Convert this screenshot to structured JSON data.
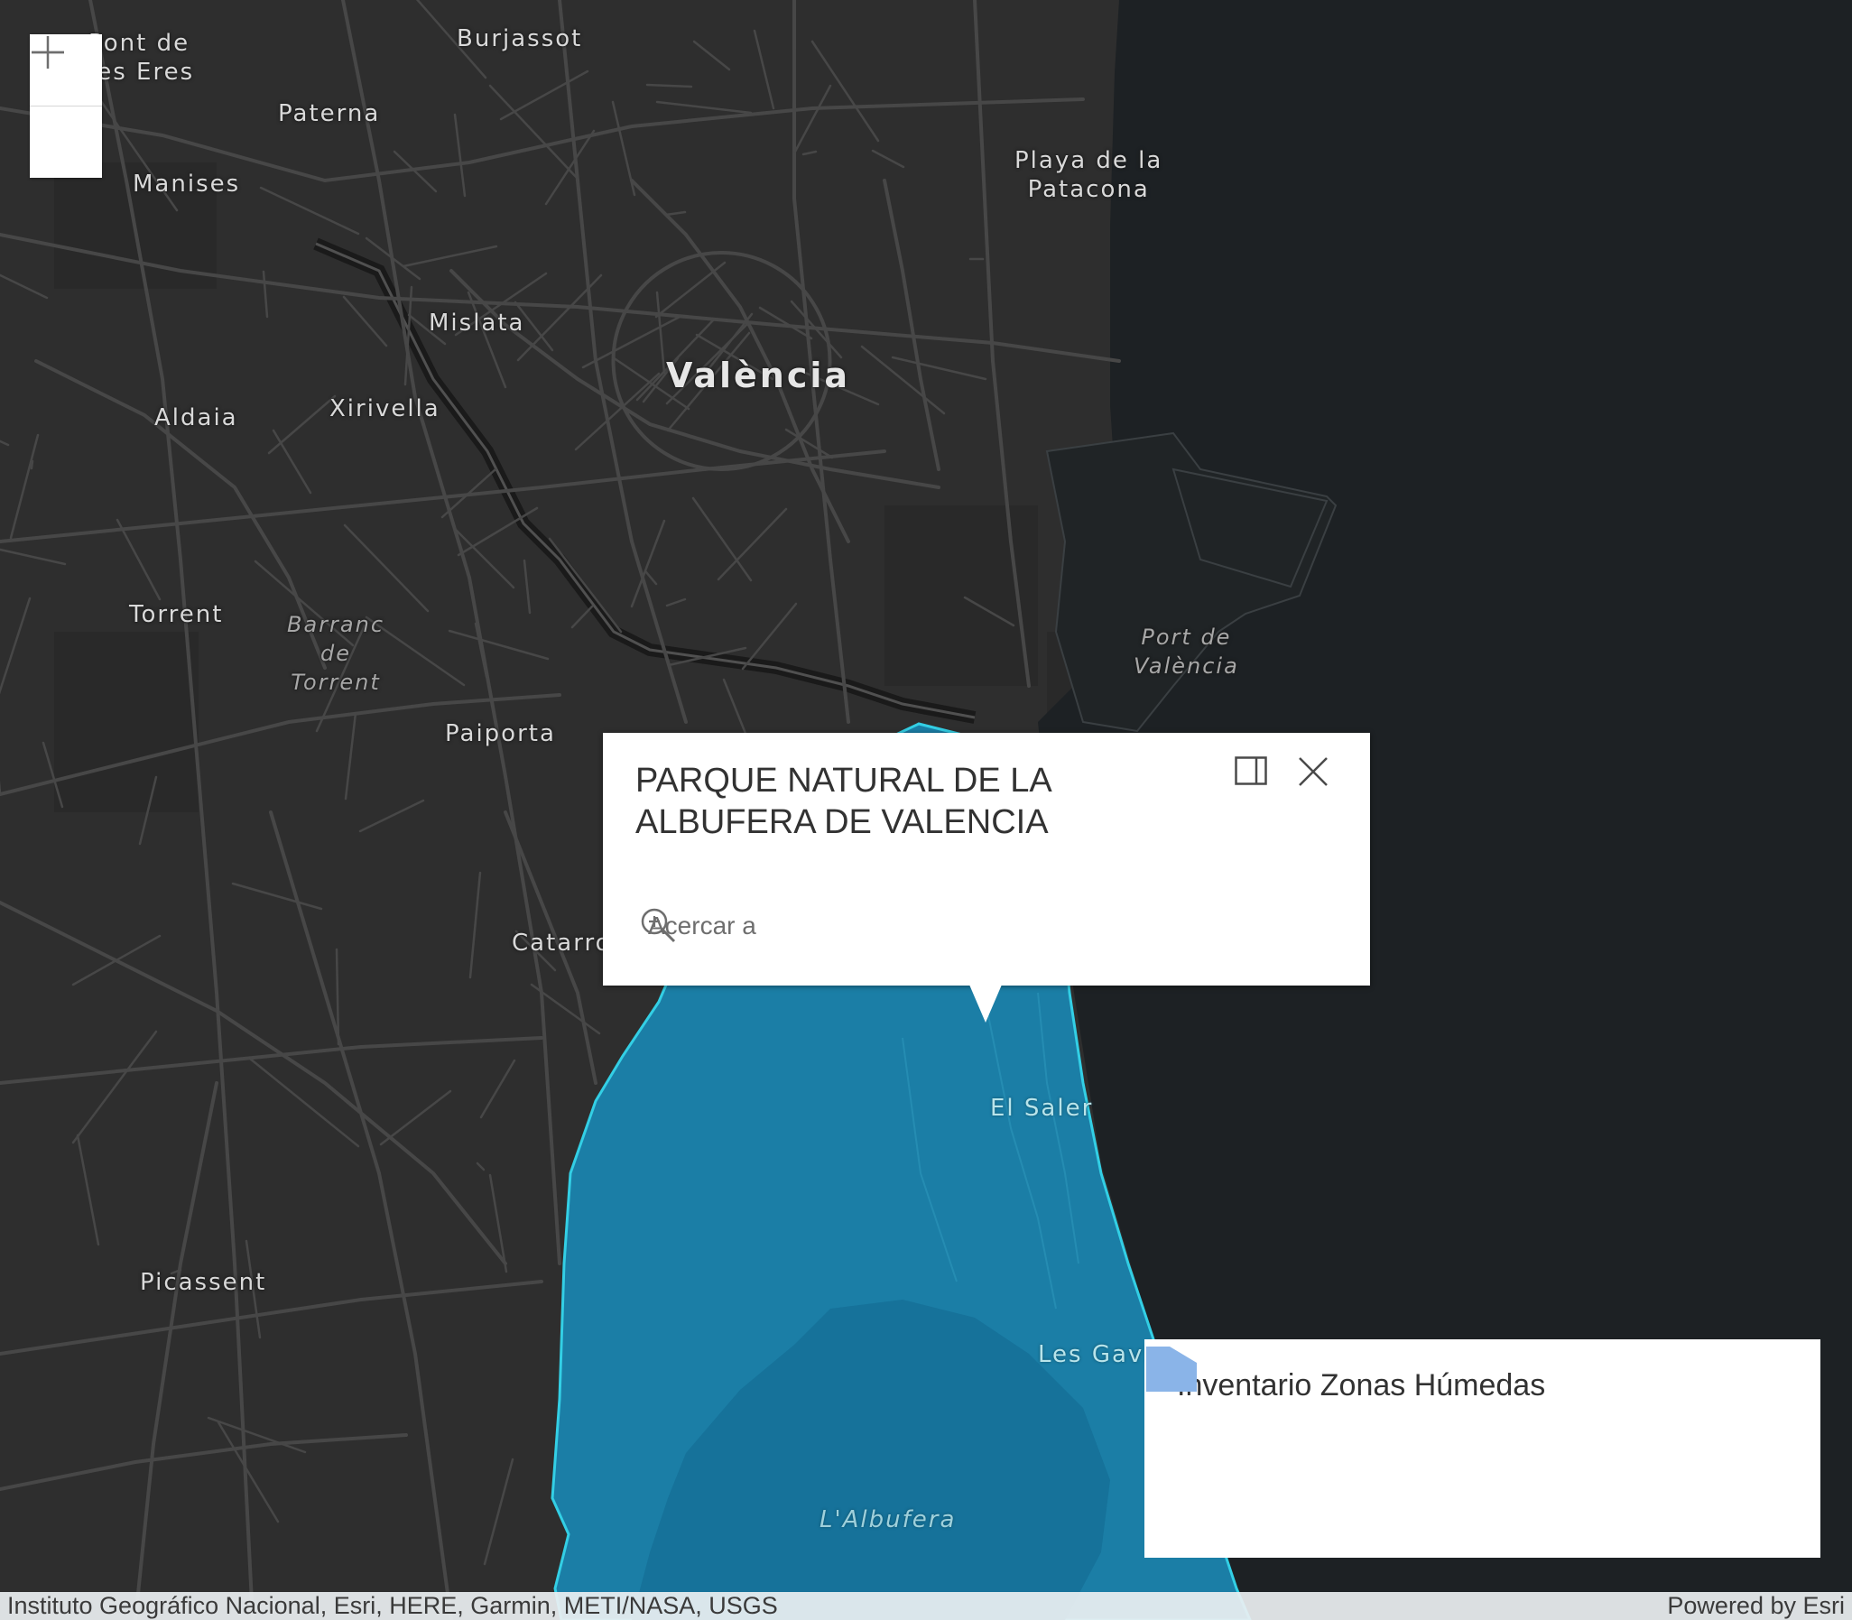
{
  "map": {
    "basemap_style": "dark-gray-canvas",
    "colors": {
      "land": "#2e2e2e",
      "water": "#1d2124",
      "roads": "#4a4a4a",
      "highlight_fill": "#1b7ea6",
      "highlight_outline": "#33cfe5"
    },
    "labels": {
      "pont_de_les_eres": "Pont de\nles Eres",
      "burjassot": "Burjassot",
      "paterna": "Paterna",
      "manises": "Manises",
      "playa_patacona": "Playa de la\nPatacona",
      "mislata": "Mislata",
      "valencia": "València",
      "aldaia": "Aldaia",
      "xirivella": "Xirivella",
      "torrent": "Torrent",
      "barranc_torrent": "Barranc\nde\nTorrent",
      "port_valencia": "Port de\nValència",
      "paiporta": "Paiporta",
      "catarroja": "Catarro",
      "el_saler": "El Saler",
      "picassent": "Picassent",
      "les_gavines": "Les Gavi",
      "albufera": "L'Albufera"
    }
  },
  "zoom": {
    "in_icon": "plus-icon",
    "out_icon": "minus-icon"
  },
  "popup": {
    "title": "PARQUE NATURAL DE LA ALBUFERA DE VALENCIA",
    "dock_icon": "dock-panel-icon",
    "close_icon": "close-icon",
    "zoom_to_label": "Acercar a",
    "zoom_to_icon": "zoom-to-magnifier-icon"
  },
  "legend": {
    "title": "Inventario Zonas Húmedas",
    "swatch_color": "#8ab4e8"
  },
  "attribution": {
    "sources": "Instituto Geográfico Nacional, Esri, HERE, Garmin, METI/NASA, USGS",
    "powered_by": "Powered by Esri"
  }
}
